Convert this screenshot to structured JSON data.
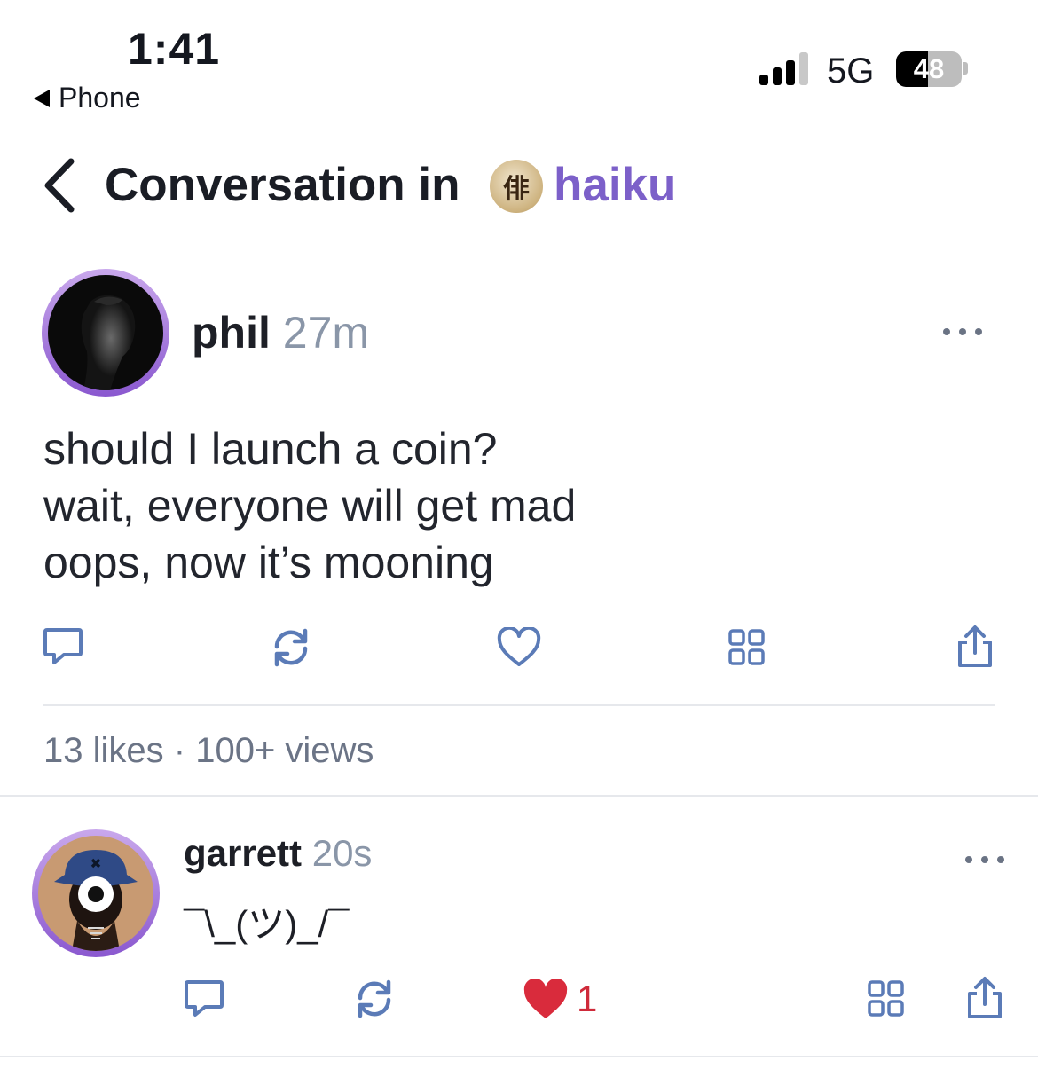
{
  "status_bar": {
    "time": "1:41",
    "back_app": "Phone",
    "network": "5G",
    "battery_level": "48",
    "battery_fraction": 0.48
  },
  "header": {
    "title": "Conversation in",
    "channel_name": "haiku",
    "channel_icon_glyph": "俳"
  },
  "post": {
    "author": "phil",
    "time_ago": "27m",
    "lines": [
      "should I launch a coin?",
      "wait, everyone will get mad",
      "oops, now it’s mooning"
    ],
    "likes": "13 likes",
    "separator": "·",
    "views": "100+ views"
  },
  "reply": {
    "author": "garrett",
    "time_ago": "20s",
    "text": "¯\\_(ツ)_/¯",
    "like_count": "1",
    "liked": true
  },
  "colors": {
    "accent": "#7c60c9",
    "muted": "#8a96a8",
    "icon": "#5b7bb7",
    "heart": "#d92b3c"
  }
}
